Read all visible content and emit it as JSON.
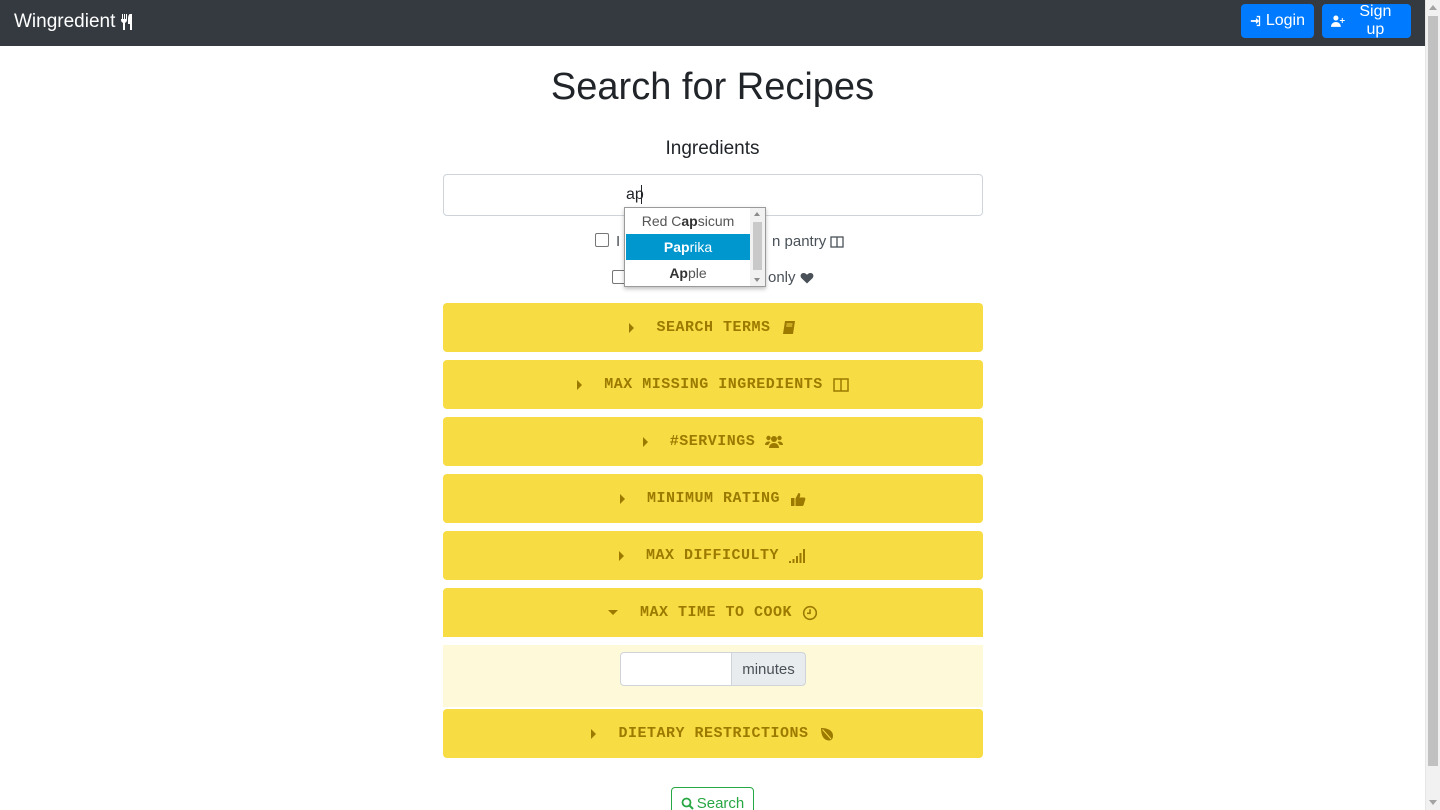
{
  "navbar": {
    "brand": "Wingredient",
    "login_label": "Login",
    "signup_label": "Sign up"
  },
  "page": {
    "title": "Search for Recipes",
    "ingredients_label": "Ingredients",
    "ingredient_input_value": "ap",
    "checkbox1_visible_start": "I",
    "checkbox1_visible_end": "n pantry",
    "checkbox2_visible_end": "only"
  },
  "autocomplete": {
    "items": [
      {
        "pre": "Red C",
        "match": "ap",
        "post": "sicum"
      },
      {
        "pre": "",
        "match": "Pap",
        "post": "rika"
      },
      {
        "pre": "",
        "match": "Ap",
        "post": "ple"
      }
    ],
    "selected_index": 1
  },
  "filters": {
    "search_terms": "SEARCH TERMS",
    "max_missing": "MAX MISSING INGREDIENTS",
    "servings": "#SERVINGS",
    "min_rating": "MINIMUM RATING",
    "max_difficulty": "MAX DIFFICULTY",
    "max_time": "MAX TIME TO COOK",
    "dietary": "DIETARY RESTRICTIONS"
  },
  "time_panel": {
    "value": "",
    "unit": "minutes"
  },
  "actions": {
    "search_label": "Search"
  },
  "colors": {
    "navbar_bg": "#343a40",
    "primary": "#007bff",
    "accordion_bg": "#f7dc44",
    "accordion_text": "#9c7a00",
    "panel_bg": "#fef9d8",
    "success": "#28a745",
    "dropdown_highlight": "#0097cf"
  },
  "icons": {
    "brand": "utensils-icon",
    "login": "sign-in-icon",
    "signup": "user-plus-icon",
    "pantry": "columns-icon",
    "favorites": "heart-icon",
    "search_terms": "book-icon",
    "max_missing": "columns-icon",
    "servings": "users-icon",
    "min_rating": "thumbs-up-icon",
    "max_difficulty": "signal-icon",
    "max_time": "clock-icon",
    "dietary": "leaf-icon",
    "search": "search-icon"
  }
}
